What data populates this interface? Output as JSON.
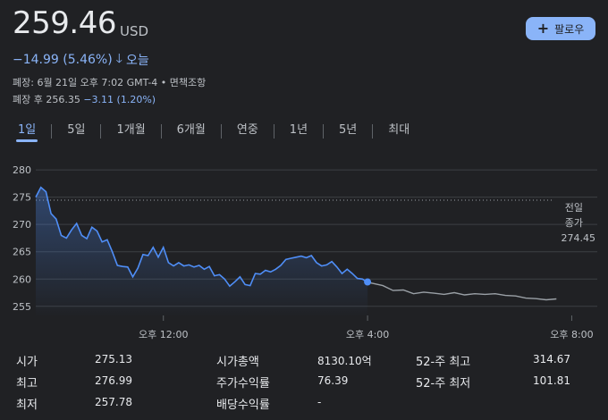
{
  "quote": {
    "price": "259.46",
    "currency": "USD",
    "change": "−14.99 (5.46%)",
    "change_arrow_icon": "arrow-down-icon",
    "period": "오늘",
    "close_info": "폐장: 6월 21일 오후 7:02 GMT-4 • 면책조항",
    "after_hours_label": "폐장 후 256.35",
    "after_hours_change": "−3.11 (1.20%)"
  },
  "follow_button": {
    "label": "팔로우",
    "icon": "plus-icon"
  },
  "tabs": [
    {
      "label": "1일",
      "active": true
    },
    {
      "label": "5일"
    },
    {
      "label": "1개월"
    },
    {
      "label": "6개월"
    },
    {
      "label": "연중"
    },
    {
      "label": "1년"
    },
    {
      "label": "5년"
    },
    {
      "label": "최대"
    }
  ],
  "chart_data": {
    "type": "line",
    "y_ticks": [
      "280",
      "275",
      "270",
      "265",
      "260",
      "255"
    ],
    "ylim": [
      253,
      281
    ],
    "x_ticks": [
      "오후 12:00",
      "오후 4:00",
      "오후 8:00"
    ],
    "x_tick_hours": [
      12,
      16,
      20
    ],
    "xlim_hours": [
      9.5,
      20.5
    ],
    "previous_close": {
      "label_line1": "전일",
      "label_line2": "종가",
      "value": "274.45",
      "y": 274.45
    },
    "series": [
      {
        "session": "regular",
        "color": "#4f8ef7",
        "x_hours": [
          9.5,
          9.6,
          9.7,
          9.8,
          9.9,
          10.0,
          10.1,
          10.2,
          10.3,
          10.4,
          10.5,
          10.6,
          10.7,
          10.8,
          10.9,
          11.0,
          11.1,
          11.2,
          11.3,
          11.4,
          11.5,
          11.6,
          11.7,
          11.8,
          11.9,
          12.0,
          12.1,
          12.2,
          12.3,
          12.4,
          12.5,
          12.6,
          12.7,
          12.8,
          12.9,
          13.0,
          13.1,
          13.2,
          13.3,
          13.4,
          13.5,
          13.6,
          13.7,
          13.8,
          13.9,
          14.0,
          14.1,
          14.2,
          14.3,
          14.4,
          14.5,
          14.6,
          14.7,
          14.8,
          14.9,
          15.0,
          15.1,
          15.2,
          15.3,
          15.4,
          15.5,
          15.6,
          15.7,
          15.8,
          15.9,
          16.0
        ],
        "y": [
          275.0,
          276.8,
          276.0,
          272.0,
          271.0,
          268.0,
          267.5,
          269.0,
          270.2,
          268.0,
          267.4,
          269.5,
          268.8,
          266.8,
          267.2,
          265.0,
          262.5,
          262.3,
          262.2,
          260.4,
          262.0,
          264.5,
          264.3,
          265.8,
          264.0,
          265.8,
          263.0,
          262.4,
          263.0,
          262.4,
          262.6,
          262.2,
          262.5,
          261.8,
          262.3,
          260.6,
          260.8,
          260.0,
          258.7,
          259.5,
          260.4,
          259.0,
          258.8,
          261.0,
          260.9,
          261.6,
          261.3,
          261.8,
          262.5,
          263.6,
          263.8,
          264.0,
          264.2,
          263.9,
          264.3,
          263.0,
          262.4,
          262.6,
          263.2,
          262.2,
          261.0,
          261.8,
          261.0,
          260.1,
          260.0,
          259.4
        ]
      },
      {
        "session": "after-hours",
        "color": "#9aa0a6",
        "x_hours": [
          16.0,
          16.1,
          16.3,
          16.5,
          16.7,
          16.9,
          17.1,
          17.3,
          17.5,
          17.7,
          17.9,
          18.1,
          18.3,
          18.5,
          18.7,
          18.9,
          19.1,
          19.3,
          19.5,
          19.7
        ],
        "y": [
          259.4,
          259.2,
          258.8,
          257.9,
          258.0,
          257.3,
          257.6,
          257.4,
          257.2,
          257.5,
          257.1,
          257.3,
          257.2,
          257.3,
          257.0,
          256.9,
          256.5,
          256.4,
          256.2,
          256.35
        ]
      }
    ],
    "last_regular_point": {
      "x_hour": 16.0,
      "y": 259.46
    }
  },
  "stats": {
    "col1": [
      {
        "label": "시가",
        "value": "275.13"
      },
      {
        "label": "최고",
        "value": "276.99"
      },
      {
        "label": "최저",
        "value": "257.78"
      }
    ],
    "col2": [
      {
        "label": "시가총액",
        "value": "8130.10억"
      },
      {
        "label": "주가수익률",
        "value": "76.39"
      },
      {
        "label": "배당수익률",
        "value": "-"
      }
    ],
    "col3": [
      {
        "label": "52-주 최고",
        "value": "314.67"
      },
      {
        "label": "52-주 최저",
        "value": "101.81"
      }
    ]
  }
}
